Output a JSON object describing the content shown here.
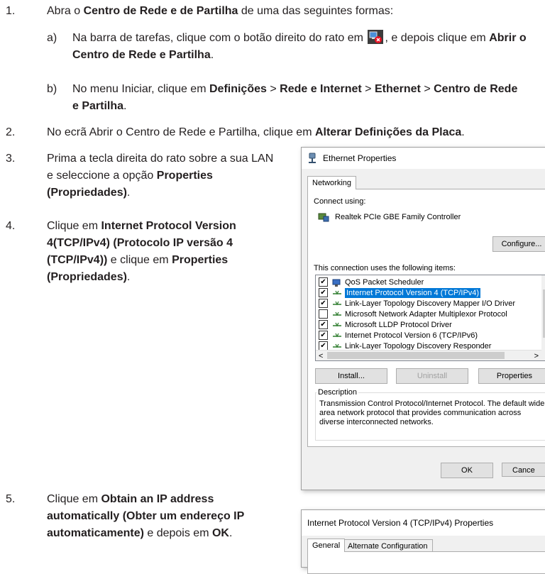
{
  "steps": {
    "s1": {
      "num": "1.",
      "pre": "Abra o ",
      "bold": "Centro de Rede e de Partilha",
      "post": " de uma das seguintes formas:"
    },
    "s1a": {
      "letter": "a)",
      "pre": "Na barra de tarefas, clique com o botão direito do rato em ",
      "mid": ", e depois clique em ",
      "bold": "Abrir o Centro de Rede e Partilha",
      "post": "."
    },
    "s1b": {
      "letter": "b)",
      "pre": "No menu Iniciar, clique em ",
      "b1": "Definições",
      "sep1": " > ",
      "b2": "Rede e Internet",
      "sep2": " > ",
      "b3": "Ethernet",
      "sep3": " > ",
      "b4": "Centro de Rede e Partilha",
      "post": "."
    },
    "s2": {
      "num": "2.",
      "pre": "No ecrã Abrir o Centro de Rede e Partilha, clique em ",
      "bold": "Alterar Definições da Placa",
      "post": "."
    },
    "s3": {
      "num": "3.",
      "pre": "Prima a tecla direita do rato sobre a sua LAN e seleccione a opção ",
      "bold": "Properties (Propriedades)",
      "post": "."
    },
    "s4": {
      "num": "4.",
      "pre": "Clique em ",
      "bold1": "Internet Protocol Version 4(TCP/IPv4) (Protocolo IP versão 4 (TCP/IPv4))",
      "mid": " e clique em ",
      "bold2": "Properties (Propriedades)",
      "post": "."
    },
    "s5": {
      "num": "5.",
      "pre": "Clique em ",
      "bold1": "Obtain an IP address automatically (Obter um endereço IP automaticamente)",
      "mid": " e depois em ",
      "bold2": "OK",
      "post": "."
    }
  },
  "ethernet_dialog": {
    "title": "Ethernet Properties",
    "tab": "Networking",
    "connect_using": "Connect using:",
    "adapter": "Realtek PCIe GBE Family Controller",
    "configure": "Configure...",
    "items_label": "This connection uses the following items:",
    "items": [
      {
        "label": "QoS Packet Scheduler",
        "checked": true,
        "icon": "qos-icon"
      },
      {
        "label": "Internet Protocol Version 4 (TCP/IPv4)",
        "checked": true,
        "icon": "protocol-icon",
        "selected": true
      },
      {
        "label": "Link-Layer Topology Discovery Mapper I/O Driver",
        "checked": true,
        "icon": "protocol-icon"
      },
      {
        "label": "Microsoft Network Adapter Multiplexor Protocol",
        "checked": false,
        "icon": "protocol-icon"
      },
      {
        "label": "Microsoft LLDP Protocol Driver",
        "checked": true,
        "icon": "protocol-icon"
      },
      {
        "label": "Internet Protocol Version 6 (TCP/IPv6)",
        "checked": true,
        "icon": "protocol-icon"
      },
      {
        "label": "Link-Layer Topology Discovery Responder",
        "checked": true,
        "icon": "protocol-icon"
      }
    ],
    "install": "Install...",
    "uninstall": "Uninstall",
    "properties": "Properties",
    "description_label": "Description",
    "description": "Transmission Control Protocol/Internet Protocol. The default wide area network protocol that provides communication across diverse interconnected networks.",
    "ok": "OK",
    "cancel": "Cance"
  },
  "ipv4_dialog": {
    "title": "Internet Protocol Version 4 (TCP/IPv4) Properties",
    "tab_general": "General",
    "tab_alternate": "Alternate Configuration"
  }
}
